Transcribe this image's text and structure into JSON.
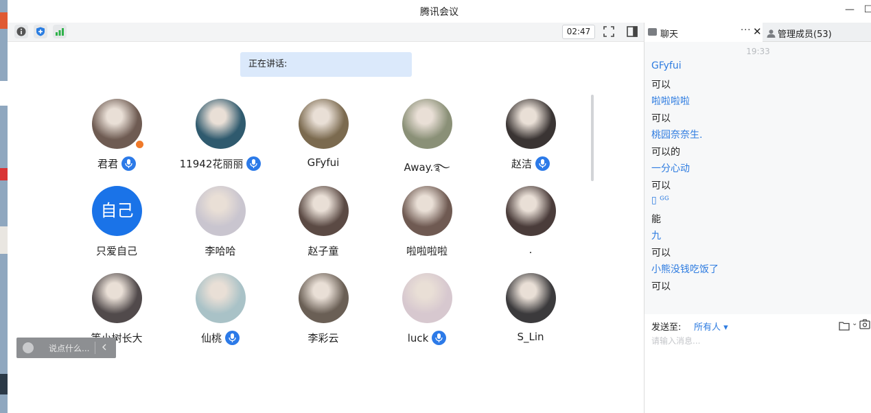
{
  "window": {
    "title": "腾讯会议",
    "minimize_glyph": "—",
    "maximize_glyph": "☐"
  },
  "toolbar": {
    "info_icon": "info-icon",
    "shield_icon": "shield-plus-icon",
    "signal_icon": "signal-bars-icon",
    "timer": "02:47",
    "fullscreen_icon": "fullscreen-icon",
    "layout_icon": "sidebar-layout-icon"
  },
  "stage": {
    "speaking_label": "正在讲话:",
    "participants": [
      {
        "name": "君君",
        "mic": true,
        "host": true,
        "avatar_color": "#6e5b52"
      },
      {
        "name": "11942花丽丽",
        "mic": true,
        "host": false,
        "avatar_color": "#2f5a6e"
      },
      {
        "name": "GFyfui",
        "mic": false,
        "host": false,
        "avatar_color": "#7b6a4f"
      },
      {
        "name": "Away.࿐",
        "mic": false,
        "host": false,
        "avatar_color": "#8a9077"
      },
      {
        "name": "赵洁",
        "mic": true,
        "host": false,
        "avatar_color": "#3a3433"
      },
      {
        "name": "只爱自己",
        "mic": false,
        "host": false,
        "self": true,
        "avatar_text": "自己",
        "avatar_color": "#1a73e8"
      },
      {
        "name": "李哈哈",
        "mic": false,
        "host": false,
        "avatar_color": "#c9c5cf"
      },
      {
        "name": "赵子童",
        "mic": false,
        "host": false,
        "avatar_color": "#5b4a44"
      },
      {
        "name": "啦啦啦啦",
        "mic": false,
        "host": false,
        "avatar_color": "#6f5a52"
      },
      {
        "name": ".",
        "mic": false,
        "host": false,
        "avatar_color": "#4a3c3a"
      },
      {
        "name": "等小树长大",
        "mic": false,
        "host": false,
        "avatar_color": "#514a4b"
      },
      {
        "name": "仙桃",
        "mic": true,
        "host": false,
        "avatar_color": "#a9c2c7"
      },
      {
        "name": "李彩云",
        "mic": false,
        "host": false,
        "avatar_color": "#6a5f55"
      },
      {
        "name": "luck",
        "mic": true,
        "host": false,
        "avatar_color": "#d7c8cf"
      },
      {
        "name": "S_Lin",
        "mic": false,
        "host": false,
        "avatar_color": "#3b3a3c"
      }
    ]
  },
  "quick_chat": {
    "emoji_icon": "emoji-icon",
    "placeholder": "说点什么...",
    "collapse_icon": "chevron-left-icon"
  },
  "panel": {
    "chat_tab_label": "聊天",
    "more_glyph": "···",
    "close_glyph": "✕",
    "members_tab_label": "管理成员(53)",
    "message_time": "19:33",
    "messages": [
      {
        "text": "GFyfui",
        "kind": "sender"
      },
      {
        "text": "可以",
        "kind": "body"
      },
      {
        "text": "啦啦啦啦",
        "kind": "sender"
      },
      {
        "text": "可以",
        "kind": "body"
      },
      {
        "text": "桃园奈奈生.",
        "kind": "sender"
      },
      {
        "text": "可以的",
        "kind": "body"
      },
      {
        "text": "一分心动",
        "kind": "sender"
      },
      {
        "text": "可以",
        "kind": "body"
      },
      {
        "text": "▯ ᴳᴳ",
        "kind": "sender"
      },
      {
        "text": "能",
        "kind": "body"
      },
      {
        "text": "九",
        "kind": "sender"
      },
      {
        "text": "可以",
        "kind": "body"
      },
      {
        "text": "小熊没钱吃饭了",
        "kind": "sender"
      },
      {
        "text": "可以",
        "kind": "body"
      }
    ],
    "send_to_label": "发送至:",
    "send_target": "所有人 ▾",
    "input_placeholder": "请输入消息...",
    "folder_icon": "folder-icon",
    "folder_chevron": "⌄",
    "screenshot_icon": "screenshot-icon"
  },
  "colors": {
    "accent": "#1a73e8",
    "sender_blue": "#2d7be0",
    "speaking_bg": "#dbe9fb"
  }
}
